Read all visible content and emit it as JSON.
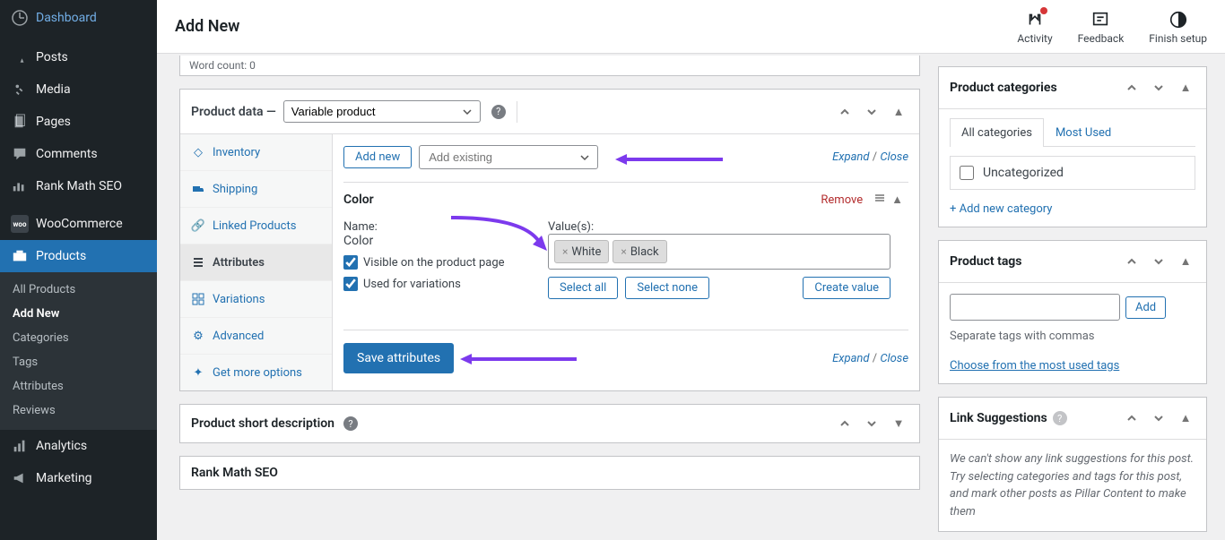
{
  "header": {
    "title": "Add New",
    "actions": {
      "activity": "Activity",
      "feedback": "Feedback",
      "finish": "Finish setup"
    }
  },
  "sidebar": {
    "items": [
      {
        "icon": "dashboard",
        "label": "Dashboard"
      },
      {
        "icon": "pin",
        "label": "Posts"
      },
      {
        "icon": "media",
        "label": "Media"
      },
      {
        "icon": "page",
        "label": "Pages"
      },
      {
        "icon": "comment",
        "label": "Comments"
      },
      {
        "icon": "chart",
        "label": "Rank Math SEO"
      },
      {
        "icon": "woo",
        "label": "WooCommerce"
      },
      {
        "icon": "products",
        "label": "Products"
      },
      {
        "icon": "analytics",
        "label": "Analytics"
      },
      {
        "icon": "marketing",
        "label": "Marketing"
      }
    ],
    "sub": {
      "items": [
        "All Products",
        "Add New",
        "Categories",
        "Tags",
        "Attributes",
        "Reviews"
      ]
    }
  },
  "wordcount": "Word count: 0",
  "product_data": {
    "heading": "Product data —",
    "type": "Variable product",
    "tabs": [
      "Inventory",
      "Shipping",
      "Linked Products",
      "Attributes",
      "Variations",
      "Advanced",
      "Get more options"
    ],
    "panel": {
      "add_new": "Add new",
      "add_existing_placeholder": "Add existing",
      "expand": "Expand",
      "close": "Close",
      "attribute": {
        "title": "Color",
        "remove": "Remove",
        "name_label": "Name:",
        "name_value": "Color",
        "visible": "Visible on the product page",
        "used": "Used for variations",
        "values_label": "Value(s):",
        "tokens": [
          "White",
          "Black"
        ],
        "select_all": "Select all",
        "select_none": "Select none",
        "create_value": "Create value"
      },
      "save": "Save attributes"
    }
  },
  "short_desc": {
    "title": "Product short description"
  },
  "seo": {
    "title": "Rank Math SEO"
  },
  "categories_box": {
    "title": "Product categories",
    "tab_all": "All categories",
    "tab_most": "Most Used",
    "item": "Uncategorized",
    "add": "+ Add new category"
  },
  "tags_box": {
    "title": "Product tags",
    "add_btn": "Add",
    "sep": "Separate tags with commas",
    "choose": "Choose from the most used tags"
  },
  "linksugg": {
    "title": "Link Suggestions",
    "text": "We can't show any link suggestions for this post. Try selecting categories and tags for this post, and mark other posts as Pillar Content to make them"
  }
}
